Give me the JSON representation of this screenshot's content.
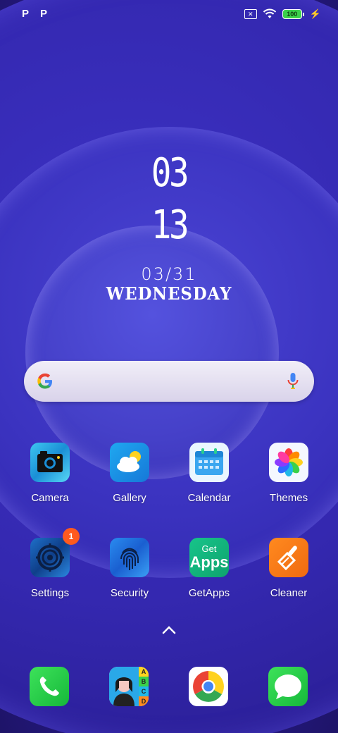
{
  "status": {
    "left_icons": [
      "P",
      "P"
    ],
    "sim_icon": "no-sim-icon",
    "wifi_icon": "wifi-icon",
    "battery_level": "100",
    "charging_icon": "⚡"
  },
  "clock": {
    "hour": "03",
    "minute": "13",
    "date": "03/31",
    "weekday": "WEDNESDAY"
  },
  "search": {
    "google_icon": "google-g-icon",
    "mic_icon": "microphone-icon"
  },
  "apps_row1": [
    {
      "label": "Camera",
      "icon": "camera-icon"
    },
    {
      "label": "Gallery",
      "icon": "gallery-icon"
    },
    {
      "label": "Calendar",
      "icon": "calendar-icon"
    },
    {
      "label": "Themes",
      "icon": "themes-icon"
    }
  ],
  "apps_row2": [
    {
      "label": "Settings",
      "icon": "settings-icon",
      "badge": "1"
    },
    {
      "label": "Security",
      "icon": "fingerprint-icon"
    },
    {
      "label": "GetApps",
      "icon": "getapps-icon",
      "icon_text_1": "Get",
      "icon_text_2": "Apps"
    },
    {
      "label": "Cleaner",
      "icon": "broom-icon"
    }
  ],
  "dock": [
    {
      "icon": "phone-icon"
    },
    {
      "icon": "contacts-icon",
      "icon_letters": [
        "A",
        "B",
        "C",
        "D"
      ]
    },
    {
      "icon": "chrome-icon"
    },
    {
      "icon": "messages-icon"
    }
  ],
  "colors": {
    "accent_badge": "#ff5a1f",
    "battery_fill": "#3bd14a"
  }
}
